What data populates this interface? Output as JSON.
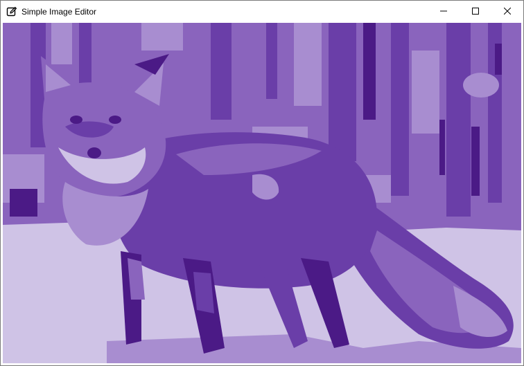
{
  "window": {
    "title": "Simple Image Editor",
    "icon": "edit-icon",
    "controls": {
      "minimize_icon": "minimize-icon",
      "maximize_icon": "maximize-icon",
      "close_icon": "close-icon"
    }
  },
  "canvas": {
    "content": "posterized purple-tint photo of a fox standing in snow",
    "palette": {
      "darkest": "#4b1a86",
      "dark": "#6a3ea8",
      "mid": "#8a64bd",
      "light": "#a88dd0",
      "lightest": "#cfc3e6"
    }
  }
}
